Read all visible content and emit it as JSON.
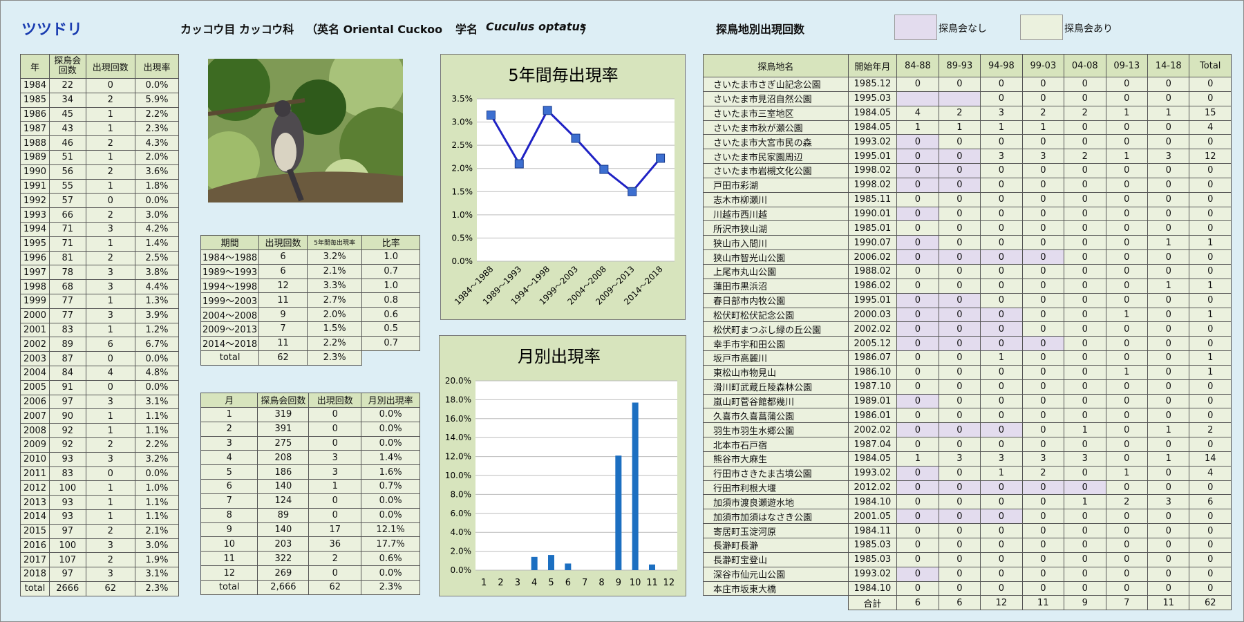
{
  "title": "ツツドリ",
  "header": {
    "order_family": "カッコウ目 カッコウ科",
    "english_prefix": "（英名 Oriental Cuckoo",
    "scientific_prefix": "学名",
    "scientific_name": "Cuculus optatus",
    "scientific_suffix": "）",
    "site_title": "探鳥地別出現回数",
    "legend_none": "探鳥会なし",
    "legend_yes": "探鳥会あり"
  },
  "colors": {
    "none": "#e3dcee",
    "yes": "#ebf1de",
    "line": "#1f22c4",
    "bar": "#1c6fc1"
  },
  "yearly": {
    "headers": [
      "年",
      "探鳥会回数",
      "出現回数",
      "出現率"
    ],
    "rows": [
      [
        "1984",
        "22",
        "0",
        "0.0%"
      ],
      [
        "1985",
        "34",
        "2",
        "5.9%"
      ],
      [
        "1986",
        "45",
        "1",
        "2.2%"
      ],
      [
        "1987",
        "43",
        "1",
        "2.3%"
      ],
      [
        "1988",
        "46",
        "2",
        "4.3%"
      ],
      [
        "1989",
        "51",
        "1",
        "2.0%"
      ],
      [
        "1990",
        "56",
        "2",
        "3.6%"
      ],
      [
        "1991",
        "55",
        "1",
        "1.8%"
      ],
      [
        "1992",
        "57",
        "0",
        "0.0%"
      ],
      [
        "1993",
        "66",
        "2",
        "3.0%"
      ],
      [
        "1994",
        "71",
        "3",
        "4.2%"
      ],
      [
        "1995",
        "71",
        "1",
        "1.4%"
      ],
      [
        "1996",
        "81",
        "2",
        "2.5%"
      ],
      [
        "1997",
        "78",
        "3",
        "3.8%"
      ],
      [
        "1998",
        "68",
        "3",
        "4.4%"
      ],
      [
        "1999",
        "77",
        "1",
        "1.3%"
      ],
      [
        "2000",
        "77",
        "3",
        "3.9%"
      ],
      [
        "2001",
        "83",
        "1",
        "1.2%"
      ],
      [
        "2002",
        "89",
        "6",
        "6.7%"
      ],
      [
        "2003",
        "87",
        "0",
        "0.0%"
      ],
      [
        "2004",
        "84",
        "4",
        "4.8%"
      ],
      [
        "2005",
        "91",
        "0",
        "0.0%"
      ],
      [
        "2006",
        "97",
        "3",
        "3.1%"
      ],
      [
        "2007",
        "90",
        "1",
        "1.1%"
      ],
      [
        "2008",
        "92",
        "1",
        "1.1%"
      ],
      [
        "2009",
        "92",
        "2",
        "2.2%"
      ],
      [
        "2010",
        "93",
        "3",
        "3.2%"
      ],
      [
        "2011",
        "83",
        "0",
        "0.0%"
      ],
      [
        "2012",
        "100",
        "1",
        "1.0%"
      ],
      [
        "2013",
        "93",
        "1",
        "1.1%"
      ],
      [
        "2014",
        "93",
        "1",
        "1.1%"
      ],
      [
        "2015",
        "97",
        "2",
        "2.1%"
      ],
      [
        "2016",
        "100",
        "3",
        "3.0%"
      ],
      [
        "2017",
        "107",
        "2",
        "1.9%"
      ],
      [
        "2018",
        "97",
        "3",
        "3.1%"
      ],
      [
        "total",
        "2666",
        "62",
        "2.3%"
      ]
    ]
  },
  "period": {
    "headers": [
      "期間",
      "出現回数",
      "5年間毎出現率",
      "比率"
    ],
    "rows": [
      [
        "1984～1988",
        "6",
        "3.2%",
        "1.0"
      ],
      [
        "1989～1993",
        "6",
        "2.1%",
        "0.7"
      ],
      [
        "1994～1998",
        "12",
        "3.3%",
        "1.0"
      ],
      [
        "1999～2003",
        "11",
        "2.7%",
        "0.8"
      ],
      [
        "2004～2008",
        "9",
        "2.0%",
        "0.6"
      ],
      [
        "2009～2013",
        "7",
        "1.5%",
        "0.5"
      ],
      [
        "2014～2018",
        "11",
        "2.2%",
        "0.7"
      ],
      [
        "total",
        "62",
        "2.3%",
        ""
      ]
    ]
  },
  "monthly": {
    "headers": [
      "月",
      "探鳥会回数",
      "出現回数",
      "月別出現率"
    ],
    "rows": [
      [
        "1",
        "319",
        "0",
        "0.0%"
      ],
      [
        "2",
        "391",
        "0",
        "0.0%"
      ],
      [
        "3",
        "275",
        "0",
        "0.0%"
      ],
      [
        "4",
        "208",
        "3",
        "1.4%"
      ],
      [
        "5",
        "186",
        "3",
        "1.6%"
      ],
      [
        "6",
        "140",
        "1",
        "0.7%"
      ],
      [
        "7",
        "124",
        "0",
        "0.0%"
      ],
      [
        "8",
        "89",
        "0",
        "0.0%"
      ],
      [
        "9",
        "140",
        "17",
        "12.1%"
      ],
      [
        "10",
        "203",
        "36",
        "17.7%"
      ],
      [
        "11",
        "322",
        "2",
        "0.6%"
      ],
      [
        "12",
        "269",
        "0",
        "0.0%"
      ],
      [
        "total",
        "2,666",
        "62",
        "2.3%"
      ]
    ]
  },
  "sites": {
    "headers": [
      "探鳥地名",
      "開始年月",
      "84-88",
      "89-93",
      "94-98",
      "99-03",
      "04-08",
      "09-13",
      "14-18",
      "Total"
    ],
    "rows": [
      [
        "さいたま市さぎ山記念公園",
        "1985.12",
        "0",
        "0",
        "0",
        "0",
        "0",
        "0",
        "0",
        "0"
      ],
      [
        "さいたま市見沼自然公園",
        "1995.03",
        "",
        "",
        "0",
        "0",
        "0",
        "0",
        "0",
        "0"
      ],
      [
        "さいたま市三室地区",
        "1984.05",
        "4",
        "2",
        "3",
        "2",
        "2",
        "1",
        "1",
        "15"
      ],
      [
        "さいたま市秋が瀬公園",
        "1984.05",
        "1",
        "1",
        "1",
        "1",
        "0",
        "0",
        "0",
        "4"
      ],
      [
        "さいたま市大宮市民の森",
        "1993.02",
        "0",
        "0",
        "0",
        "0",
        "0",
        "0",
        "0",
        "0"
      ],
      [
        "さいたま市民家園周辺",
        "1995.01",
        "0",
        "0",
        "3",
        "3",
        "2",
        "1",
        "3",
        "12"
      ],
      [
        "さいたま市岩槻文化公園",
        "1998.02",
        "0",
        "0",
        "0",
        "0",
        "0",
        "0",
        "0",
        "0"
      ],
      [
        "戸田市彩湖",
        "1998.02",
        "0",
        "0",
        "0",
        "0",
        "0",
        "0",
        "0",
        "0"
      ],
      [
        "志木市柳瀬川",
        "1985.11",
        "0",
        "0",
        "0",
        "0",
        "0",
        "0",
        "0",
        "0"
      ],
      [
        "川越市西川越",
        "1990.01",
        "0",
        "0",
        "0",
        "0",
        "0",
        "0",
        "0",
        "0"
      ],
      [
        "所沢市狭山湖",
        "1985.01",
        "0",
        "0",
        "0",
        "0",
        "0",
        "0",
        "0",
        "0"
      ],
      [
        "狭山市入間川",
        "1990.07",
        "0",
        "0",
        "0",
        "0",
        "0",
        "0",
        "1",
        "1"
      ],
      [
        "狭山市智光山公園",
        "2006.02",
        "0",
        "0",
        "0",
        "0",
        "0",
        "0",
        "0",
        "0"
      ],
      [
        "上尾市丸山公園",
        "1988.02",
        "0",
        "0",
        "0",
        "0",
        "0",
        "0",
        "0",
        "0"
      ],
      [
        "蓮田市黒浜沼",
        "1986.02",
        "0",
        "0",
        "0",
        "0",
        "0",
        "0",
        "1",
        "1"
      ],
      [
        "春日部市内牧公園",
        "1995.01",
        "0",
        "0",
        "0",
        "0",
        "0",
        "0",
        "0",
        "0"
      ],
      [
        "松伏町松伏記念公園",
        "2000.03",
        "0",
        "0",
        "0",
        "0",
        "0",
        "1",
        "0",
        "1"
      ],
      [
        "松伏町まつぶし緑の丘公園",
        "2002.02",
        "0",
        "0",
        "0",
        "0",
        "0",
        "0",
        "0",
        "0"
      ],
      [
        "幸手市宇和田公園",
        "2005.12",
        "0",
        "0",
        "0",
        "0",
        "0",
        "0",
        "0",
        "0"
      ],
      [
        "坂戸市高麗川",
        "1986.07",
        "0",
        "0",
        "1",
        "0",
        "0",
        "0",
        "0",
        "1"
      ],
      [
        "東松山市物見山",
        "1986.10",
        "0",
        "0",
        "0",
        "0",
        "0",
        "1",
        "0",
        "1"
      ],
      [
        "滑川町武蔵丘陵森林公園",
        "1987.10",
        "0",
        "0",
        "0",
        "0",
        "0",
        "0",
        "0",
        "0"
      ],
      [
        "嵐山町菅谷館都幾川",
        "1989.01",
        "0",
        "0",
        "0",
        "0",
        "0",
        "0",
        "0",
        "0"
      ],
      [
        "久喜市久喜菖蒲公園",
        "1986.01",
        "0",
        "0",
        "0",
        "0",
        "0",
        "0",
        "0",
        "0"
      ],
      [
        "羽生市羽生水郷公園",
        "2002.02",
        "0",
        "0",
        "0",
        "0",
        "1",
        "0",
        "1",
        "2"
      ],
      [
        "北本市石戸宿",
        "1987.04",
        "0",
        "0",
        "0",
        "0",
        "0",
        "0",
        "0",
        "0"
      ],
      [
        "熊谷市大麻生",
        "1984.05",
        "1",
        "3",
        "3",
        "3",
        "3",
        "0",
        "1",
        "14"
      ],
      [
        "行田市さきたま古墳公園",
        "1993.02",
        "0",
        "0",
        "1",
        "2",
        "0",
        "1",
        "0",
        "4"
      ],
      [
        "行田市利根大堰",
        "2012.02",
        "0",
        "0",
        "0",
        "0",
        "0",
        "0",
        "0",
        "0"
      ],
      [
        "加須市渡良瀬遊水地",
        "1984.10",
        "0",
        "0",
        "0",
        "0",
        "1",
        "2",
        "3",
        "6"
      ],
      [
        "加須市加須はなさき公園",
        "2001.05",
        "0",
        "0",
        "0",
        "0",
        "0",
        "0",
        "0",
        "0"
      ],
      [
        "寄居町玉淀河原",
        "1984.11",
        "0",
        "0",
        "0",
        "0",
        "0",
        "0",
        "0",
        "0"
      ],
      [
        "長瀞町長瀞",
        "1985.03",
        "0",
        "0",
        "0",
        "0",
        "0",
        "0",
        "0",
        "0"
      ],
      [
        "長瀞町宝登山",
        "1985.03",
        "0",
        "0",
        "0",
        "0",
        "0",
        "0",
        "0",
        "0"
      ],
      [
        "深谷市仙元山公園",
        "1993.02",
        "0",
        "0",
        "0",
        "0",
        "0",
        "0",
        "0",
        "0"
      ],
      [
        "本庄市坂東大橋",
        "1984.10",
        "0",
        "0",
        "0",
        "0",
        "0",
        "0",
        "0",
        "0"
      ]
    ],
    "total_label": "合計",
    "totals": [
      "6",
      "6",
      "12",
      "11",
      "9",
      "7",
      "11",
      "62"
    ]
  },
  "chart_data": [
    {
      "type": "line",
      "title": "5年間毎出現率",
      "categories": [
        "1984～1988",
        "1989～1993",
        "1994～1998",
        "1999～2003",
        "2004～2008",
        "2009～2013",
        "2014～2018"
      ],
      "values": [
        3.15,
        2.1,
        3.25,
        2.65,
        1.98,
        1.5,
        2.22
      ],
      "ylim": [
        0,
        3.5
      ],
      "yticks": [
        "0.0%",
        "0.5%",
        "1.0%",
        "1.5%",
        "2.0%",
        "2.5%",
        "3.0%",
        "3.5%"
      ],
      "grid": true
    },
    {
      "type": "bar",
      "title": "月別出現率",
      "categories": [
        "1",
        "2",
        "3",
        "4",
        "5",
        "6",
        "7",
        "8",
        "9",
        "10",
        "11",
        "12"
      ],
      "values": [
        0,
        0,
        0,
        1.4,
        1.6,
        0.7,
        0,
        0,
        12.1,
        17.7,
        0.6,
        0
      ],
      "ylim": [
        0,
        20
      ],
      "yticks": [
        "0.0%",
        "2.0%",
        "4.0%",
        "6.0%",
        "8.0%",
        "10.0%",
        "12.0%",
        "14.0%",
        "16.0%",
        "18.0%",
        "20.0%"
      ],
      "grid": true
    }
  ]
}
